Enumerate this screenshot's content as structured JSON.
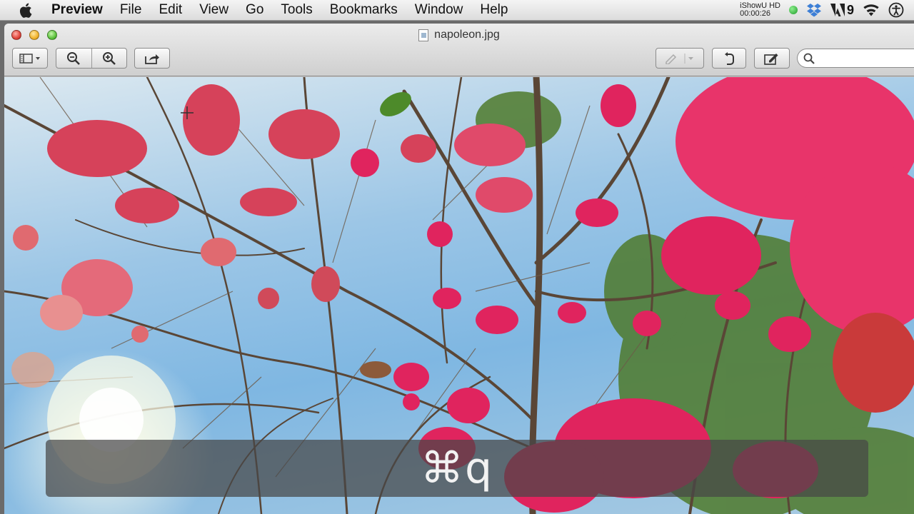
{
  "menubar": {
    "app_name": "Preview",
    "items": [
      "File",
      "Edit",
      "View",
      "Go",
      "Tools",
      "Bookmarks",
      "Window",
      "Help"
    ],
    "recorder_name": "iShowU HD",
    "recorder_time": "00:00:26",
    "adobe_count": "9"
  },
  "window": {
    "title": "napoleon.jpg"
  },
  "toolbar": {
    "search_placeholder": ""
  },
  "overlay": {
    "shortcut_text": "⌘q"
  },
  "colors": {
    "flower": "#e0245e",
    "sky": "#8cc0e6",
    "branch": "#5a4636"
  }
}
